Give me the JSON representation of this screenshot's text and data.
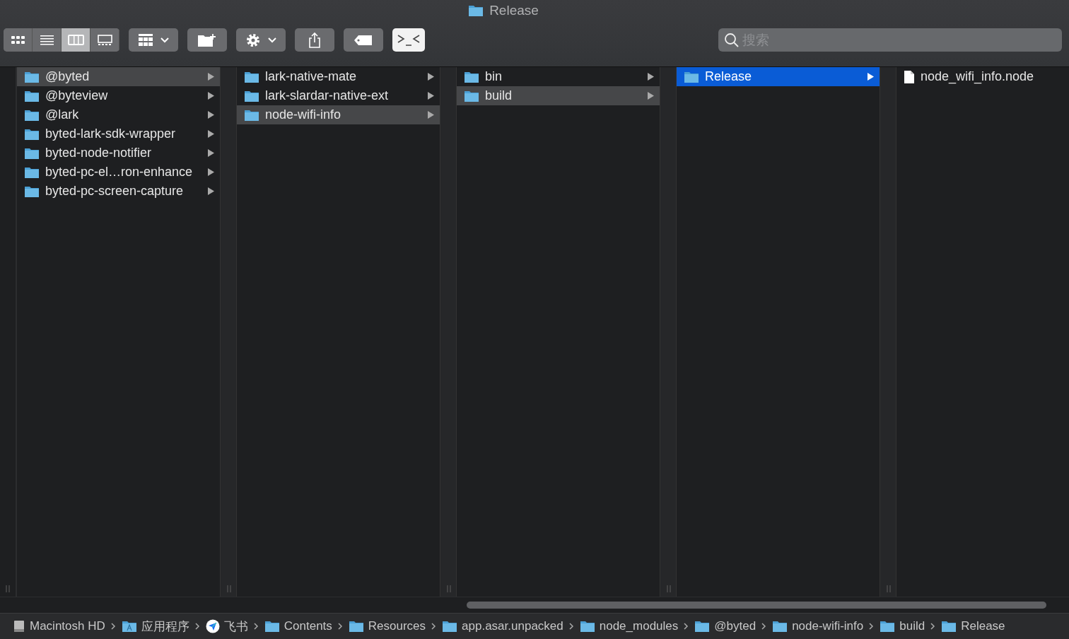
{
  "window": {
    "title": "Release"
  },
  "toolbar": {
    "view_modes": [
      {
        "kind": "icons",
        "selected": false
      },
      {
        "kind": "list",
        "selected": false
      },
      {
        "kind": "columns",
        "selected": true
      },
      {
        "kind": "gallery",
        "selected": false
      }
    ],
    "tools": [
      {
        "kind": "arrange"
      },
      {
        "kind": "new-folder"
      },
      {
        "kind": "action"
      },
      {
        "kind": "share"
      },
      {
        "kind": "tag"
      },
      {
        "kind": "terminal"
      }
    ]
  },
  "search": {
    "placeholder": "搜索"
  },
  "columns": [
    {
      "focused": false,
      "items": [
        {
          "kind": "folder",
          "name": "@byted",
          "selected": true
        },
        {
          "kind": "folder",
          "name": "@byteview",
          "selected": false
        },
        {
          "kind": "folder",
          "name": "@lark",
          "selected": false
        },
        {
          "kind": "folder",
          "name": "byted-lark-sdk-wrapper",
          "selected": false
        },
        {
          "kind": "folder",
          "name": "byted-node-notifier",
          "selected": false
        },
        {
          "kind": "folder",
          "name": "byted-pc-el…ron-enhance",
          "selected": false
        },
        {
          "kind": "folder",
          "name": "byted-pc-screen-capture",
          "selected": false
        }
      ]
    },
    {
      "focused": false,
      "items": [
        {
          "kind": "folder",
          "name": "lark-native-mate",
          "selected": false
        },
        {
          "kind": "folder",
          "name": "lark-slardar-native-ext",
          "selected": false
        },
        {
          "kind": "folder",
          "name": "node-wifi-info",
          "selected": true
        }
      ]
    },
    {
      "focused": false,
      "items": [
        {
          "kind": "folder",
          "name": "bin",
          "selected": false
        },
        {
          "kind": "folder",
          "name": "build",
          "selected": true
        }
      ]
    },
    {
      "focused": true,
      "items": [
        {
          "kind": "folder",
          "name": "Release",
          "selected": true
        }
      ]
    },
    {
      "items": [
        {
          "kind": "file",
          "name": "node_wifi_info.node",
          "selected": false
        }
      ]
    }
  ],
  "path_bar": [
    {
      "kind": "disk",
      "name": "Macintosh HD"
    },
    {
      "kind": "apps",
      "name": "应用程序"
    },
    {
      "kind": "app",
      "name": "飞书"
    },
    {
      "kind": "folder",
      "name": "Contents"
    },
    {
      "kind": "folder",
      "name": "Resources"
    },
    {
      "kind": "folder",
      "name": "app.asar.unpacked"
    },
    {
      "kind": "folder",
      "name": "node_modules"
    },
    {
      "kind": "folder",
      "name": "@byted"
    },
    {
      "kind": "folder",
      "name": "node-wifi-info"
    },
    {
      "kind": "folder",
      "name": "build"
    },
    {
      "kind": "folder",
      "name": "Release"
    }
  ]
}
